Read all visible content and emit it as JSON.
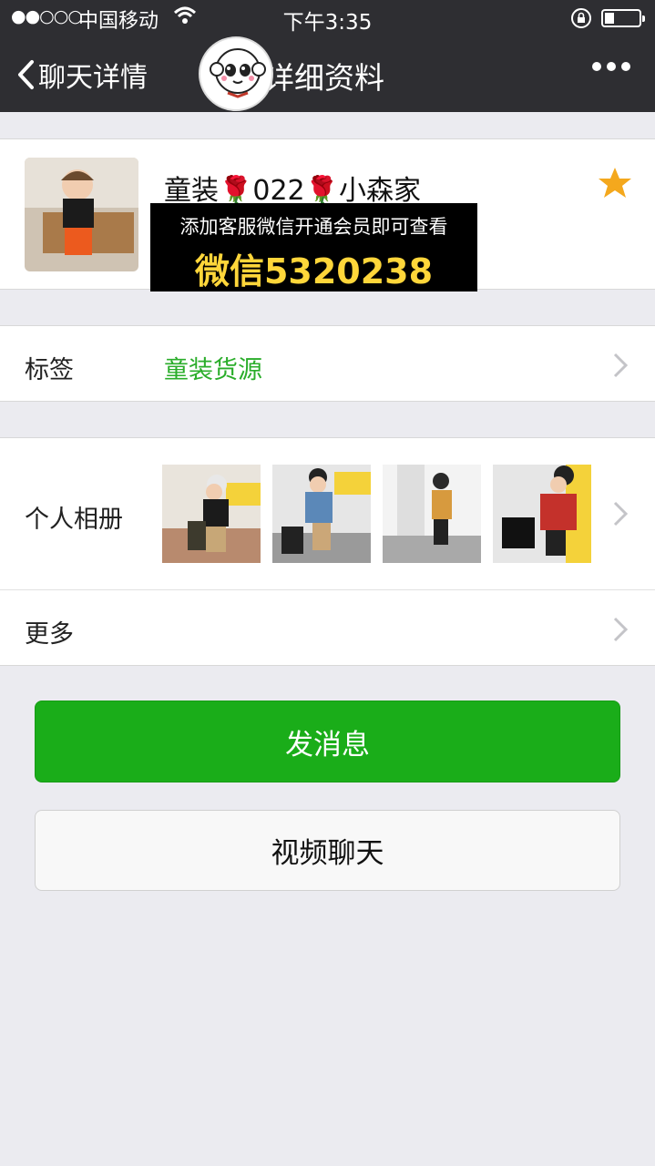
{
  "status_bar": {
    "signal": "●●○○○",
    "carrier": "中国移动",
    "time": "下午3:35"
  },
  "nav": {
    "back_label": "聊天详情",
    "title": "详细资料"
  },
  "profile": {
    "name": "童装🌹022🌹小森家",
    "starred": true
  },
  "promo": {
    "line1": "添加客服微信开通会员即可查看",
    "line2": "微信5320238"
  },
  "tags_row": {
    "label": "标签",
    "value": "童装货源"
  },
  "album_row": {
    "label": "个人相册"
  },
  "more_row": {
    "label": "更多"
  },
  "buttons": {
    "send_message": "发消息",
    "video_call": "视频聊天"
  },
  "colors": {
    "nav_bg": "#2e2e32",
    "accent_green": "#1aad19",
    "tag_green": "#2aad2a",
    "star": "#f4a81d",
    "promo_yellow": "#ffd63a"
  }
}
